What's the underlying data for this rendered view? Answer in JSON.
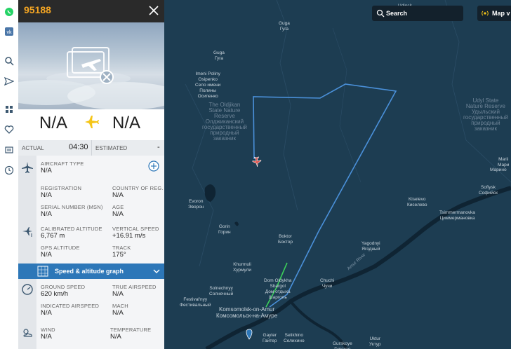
{
  "flight": {
    "id": "95188",
    "origin": "N/A",
    "destination": "N/A",
    "actual_label": "ACTUAL",
    "actual_time": "04:30",
    "estimated_label": "ESTIMATED",
    "estimated_time": "-"
  },
  "aircraft": {
    "type_label": "AIRCRAFT TYPE",
    "type_value": "N/A",
    "registration_label": "REGISTRATION",
    "registration_value": "N/A",
    "country_label": "COUNTRY OF REG.",
    "country_value": "N/A",
    "serial_label": "SERIAL NUMBER (MSN)",
    "serial_value": "N/A",
    "age_label": "AGE",
    "age_value": "N/A"
  },
  "altitude": {
    "calibrated_label": "CALIBRATED ALTITUDE",
    "calibrated_value": "6,767 m",
    "vertical_label": "VERTICAL SPEED",
    "vertical_value": "+16.91 m/s",
    "gps_label": "GPS ALTITUDE",
    "gps_value": "N/A",
    "track_label": "TRACK",
    "track_value": "175°"
  },
  "graph": {
    "label": "Speed & altitude graph"
  },
  "speed": {
    "ground_label": "GROUND SPEED",
    "ground_value": "620 km/h",
    "true_label": "TRUE AIRSPEED",
    "true_value": "N/A",
    "indicated_label": "INDICATED AIRSPEED",
    "indicated_value": "N/A",
    "mach_label": "MACH",
    "mach_value": "N/A"
  },
  "weather": {
    "wind_label": "WIND",
    "wind_value": "N/A",
    "temp_label": "TEMPERATURE",
    "temp_value": "N/A"
  },
  "map": {
    "search_label": "Search",
    "view_label": "Map v",
    "places": {
      "udinsk": "Udinsk",
      "guga1": "Guga\nГуга",
      "guga2": "Guga\nГуга",
      "imeni": "Imeni Poliny\nOsipenko\nСело имени\nПолины\nОсипенко",
      "reserve": "The Oldjikan\nState Nature\nReserve\nОлджиканский\nгосударственный\nприродный\nзаказник",
      "udyl": "Udyl State\nNature Reserve\nУдыльский\nгосударственный\nприродный\nзаказник",
      "mari": "Marii\nМари",
      "marino": "Марино",
      "evoron": "Evoron\nЭворон",
      "gorin": "Gorin\nГорин",
      "boktor": "Boktor\nБоктор",
      "kiselevo": "Kiselevo\nКиселево",
      "sofiysk": "Sofiysk\nСофийск",
      "tsimmer": "Tsimmermanovka\nЦиммермановка",
      "yagodny": "Yagodnyi\nЯгодный",
      "khurmuli": "Khurmuli\nХурмули",
      "dom": "Dom Oldykha\nSbargol\nДом отдыха\nШарголь",
      "chuchi": "Chuchi\nЧучи",
      "solnechny": "Solnechnyy\nСолнечный",
      "festivalny": "Festival'nyy\nФестивальный",
      "komsomolsk": "Komsomolsk-on-Amur\nКомсомольск-на-Амуре",
      "gayter": "Gayter\nГайтер",
      "selikhino": "Selikhino\nСелихино",
      "ukur": "Uktur\nУктур",
      "gurskoye": "Gurskoye\nГурское",
      "amur": "Amur River"
    }
  },
  "colors": {
    "accent": "#f5a623",
    "track_blue": "#4a90d9",
    "track_green": "#3ccf5a",
    "plane": "#e0524c",
    "graph_bar": "#2d77b8"
  }
}
